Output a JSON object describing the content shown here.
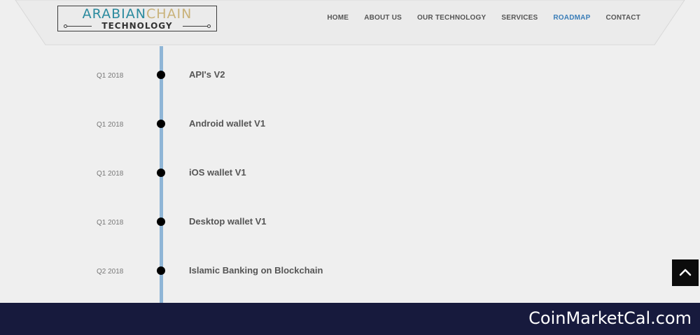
{
  "header": {
    "logo": {
      "word1": "ARABIAN",
      "word2": "CHAIN",
      "subtitle": "TECHNOLOGY"
    },
    "nav": [
      {
        "label": "HOME",
        "active": false
      },
      {
        "label": "ABOUT US",
        "active": false
      },
      {
        "label": "OUR TECHNOLOGY",
        "active": false
      },
      {
        "label": "SERVICES",
        "active": false
      },
      {
        "label": "ROADMAP",
        "active": true
      },
      {
        "label": "CONTACT",
        "active": false
      }
    ]
  },
  "roadmap": [
    {
      "date": "Q1 2018",
      "title": "API's V2"
    },
    {
      "date": "Q1 2018",
      "title": "Android wallet V1"
    },
    {
      "date": "Q1 2018",
      "title": "iOS wallet V1"
    },
    {
      "date": "Q1 2018",
      "title": "Desktop wallet V1"
    },
    {
      "date": "Q2 2018",
      "title": "Islamic Banking on Blockchain"
    }
  ],
  "footer": {
    "brand": "CoinMarketCal.com"
  },
  "colors": {
    "accent": "#3a7db8",
    "timeline": "#8fb5d6",
    "footer_bg": "#171a3d",
    "logo_teal": "#2a8a9e",
    "logo_gold": "#c9b27a"
  },
  "icons": {
    "back_to_top": "chevron-up-icon"
  }
}
